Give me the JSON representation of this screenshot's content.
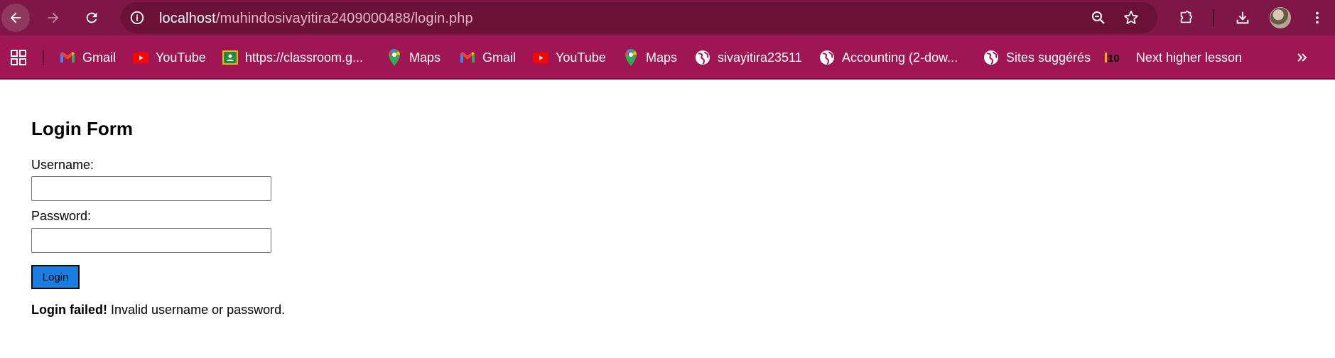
{
  "browser": {
    "url_host": "localhost",
    "url_path": "/muhindosivayitira2409000488/login.php",
    "accent_colors": {
      "toolbar": "#7e1746",
      "bookmarks_bar": "#a01553",
      "omnibox": "#6b1138"
    },
    "toolbar_icons": [
      "back-icon",
      "forward-icon",
      "reload-icon",
      "site-info-icon",
      "zoom-icon",
      "star-icon",
      "extensions-icon",
      "download-icon",
      "avatar",
      "menu-icon"
    ]
  },
  "bookmarks": [
    {
      "label": "Gmail",
      "icon": "gmail-icon"
    },
    {
      "label": "YouTube",
      "icon": "youtube-icon"
    },
    {
      "label": "https://classroom.g...",
      "icon": "classroom-icon"
    },
    {
      "label": "Maps",
      "icon": "maps-icon"
    },
    {
      "label": "Gmail",
      "icon": "gmail-icon"
    },
    {
      "label": "YouTube",
      "icon": "youtube-icon"
    },
    {
      "label": "Maps",
      "icon": "maps-icon"
    },
    {
      "label": "sivayitira23511",
      "icon": "globe-icon"
    },
    {
      "label": "Accounting (2-dow...",
      "icon": "globe-icon"
    },
    {
      "label": "Sites suggérés",
      "icon": "globe-icon"
    },
    {
      "label": "Next higher lesson",
      "icon": "t10-icon"
    }
  ],
  "t10_logo_text": "10",
  "form": {
    "title": "Login Form",
    "username_label": "Username:",
    "username_value": "",
    "password_label": "Password:",
    "password_value": "",
    "login_button": "Login",
    "button_color": "#1a7de0",
    "message_strong": "Login failed!",
    "message_text": " Invalid username or password."
  }
}
